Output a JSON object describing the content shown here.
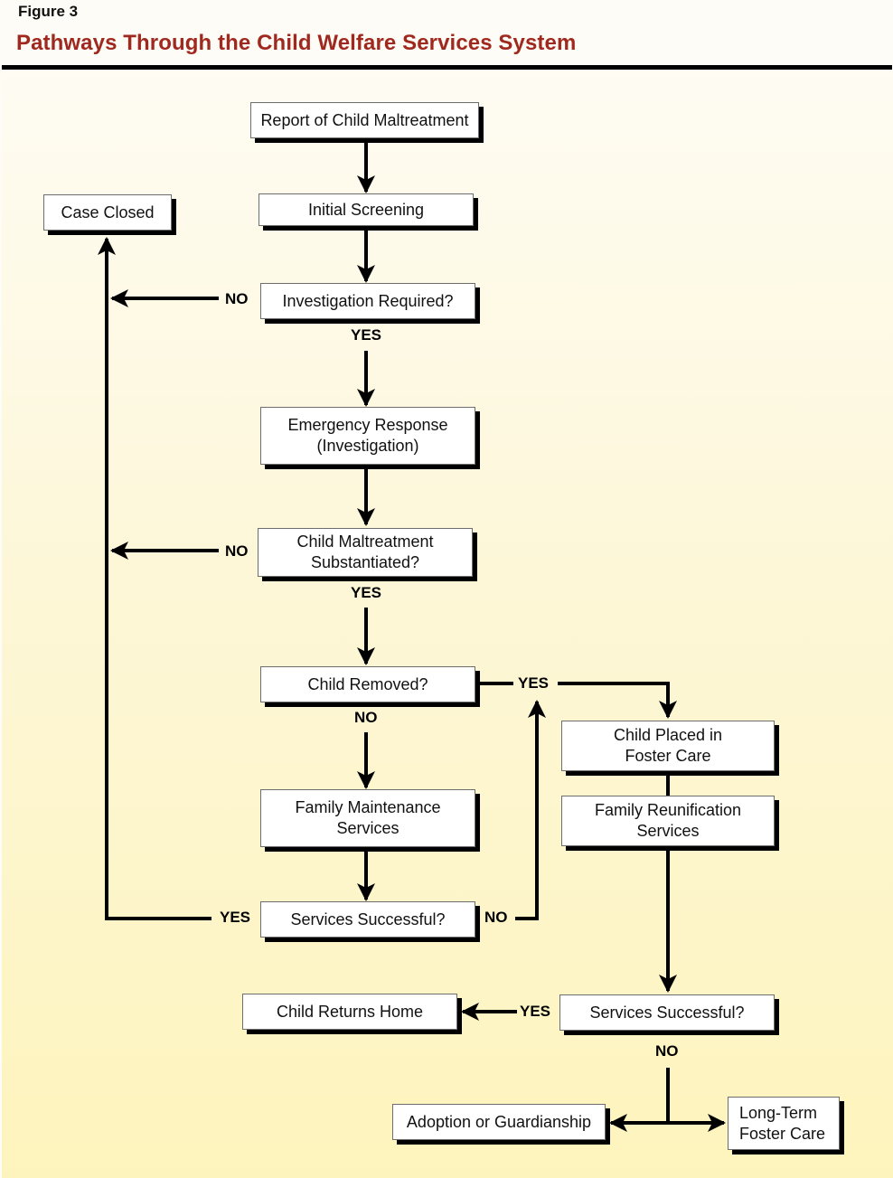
{
  "figure": {
    "label": "Figure 3",
    "title": "Pathways Through the Child Welfare Services System",
    "title_color": "#a0291f"
  },
  "nodes": {
    "report": "Report of Child Maltreatment",
    "case_closed": "Case Closed",
    "initial_screening": "Initial Screening",
    "investigation_required": "Investigation Required?",
    "emergency_response": "Emergency Response\n(Investigation)",
    "substantiated": "Child Maltreatment\nSubstantiated?",
    "child_removed": "Child Removed?",
    "family_maintenance": "Family Maintenance\nServices",
    "services_successful_left": "Services Successful?",
    "foster_care": "Child Placed in\nFoster Care",
    "family_reunification": "Family Reunification\nServices",
    "services_successful_right": "Services Successful?",
    "child_returns_home": "Child Returns Home",
    "adoption": "Adoption or Guardianship",
    "long_term_foster": "Long-Term\nFoster Care"
  },
  "edge_labels": {
    "investigation_no": "NO",
    "investigation_yes": "YES",
    "substantiated_no": "NO",
    "substantiated_yes": "YES",
    "removed_yes": "YES",
    "removed_no": "NO",
    "left_success_yes": "YES",
    "left_success_no": "NO",
    "right_success_yes": "YES",
    "right_success_no": "NO"
  }
}
